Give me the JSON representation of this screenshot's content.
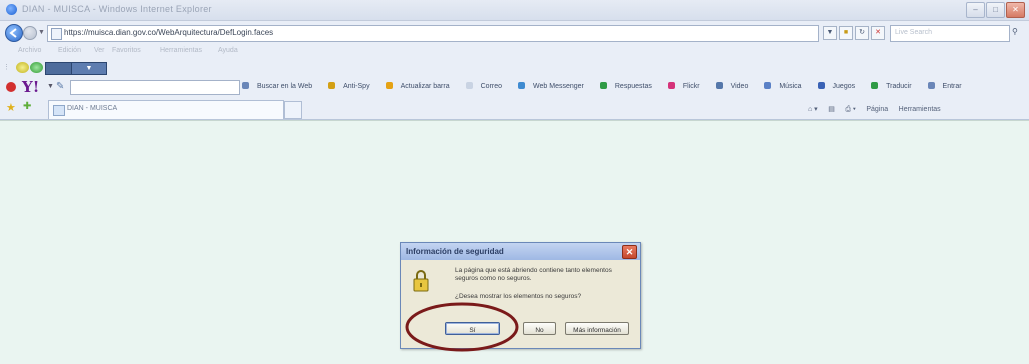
{
  "window": {
    "title": "DIAN - MUISCA - Windows Internet Explorer",
    "controls": [
      "minimize",
      "maximize",
      "close"
    ]
  },
  "address_bar": {
    "url": "https://muisca.dian.gov.co/WebArquitectura/DefLogin.faces",
    "search_placeholder": "Live Search"
  },
  "menu": {
    "items": [
      "Archivo",
      "Edición",
      "Ver",
      "Favoritos",
      "Herramientas",
      "Ayuda"
    ]
  },
  "yahoo_toolbar": {
    "logo": "Y!",
    "items": [
      "Buscar en la Web",
      "Anti-Spy",
      "Actualizar barra",
      "Correo",
      "Web Messenger",
      "Respuestas",
      "Flickr",
      "Video",
      "Música",
      "Juegos",
      "Traducir",
      "Entrar"
    ]
  },
  "tabs": {
    "active_title": "DIAN - MUISCA"
  },
  "command_bar": {
    "items": [
      "Página",
      "Herramientas"
    ]
  },
  "dialog": {
    "title": "Información de seguridad",
    "message": "La página que está abriendo contiene tanto elementos seguros como no seguros.",
    "question": "¿Desea mostrar los elementos no seguros?",
    "buttons": {
      "yes": "Sí",
      "no": "No",
      "more": "Más información"
    }
  },
  "colors": {
    "highlight_ellipse": "#7a1a1a",
    "content_background": "#eaf5f1",
    "dialog_background": "#ece9d8"
  }
}
